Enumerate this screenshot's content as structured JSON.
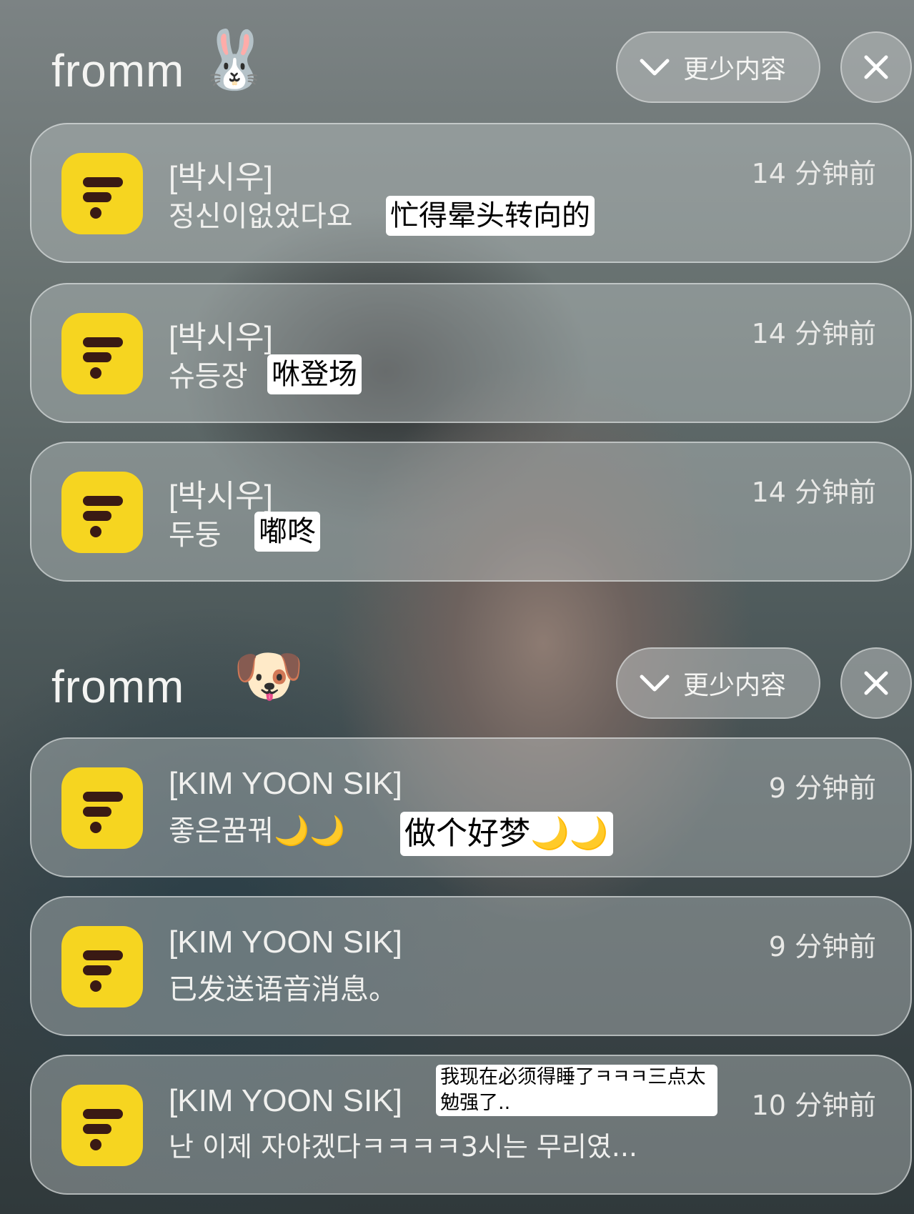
{
  "groups": [
    {
      "app_name": "fromm",
      "collapse_label": "更少内容",
      "notifications": [
        {
          "sender": "[박시우]",
          "message": "정신이없었다요",
          "translation": "忙得晕头转向的",
          "time": "14 分钟前"
        },
        {
          "sender": "[박시우]",
          "message": "슈등장",
          "translation": "咻登场",
          "time": "14 分钟前"
        },
        {
          "sender": "[박시우]",
          "message": "두둥",
          "translation": "嘟咚",
          "time": "14 分钟前"
        }
      ]
    },
    {
      "app_name": "fromm",
      "collapse_label": "更少内容",
      "notifications": [
        {
          "sender": "[KIM YOON SIK]",
          "message": "좋은꿈꿔🌙🌙",
          "translation": "做个好梦🌙🌙",
          "time": "9 分钟前"
        },
        {
          "sender": "[KIM YOON SIK]",
          "message": "已发送语音消息。",
          "time": "9 分钟前"
        },
        {
          "sender": "[KIM YOON SIK]",
          "message": "난 이제 자야겠다ㅋㅋㅋㅋ3시는 무리였...",
          "translation": "我现在必须得睡了ㅋㅋㅋ三点太勉强了..",
          "time": "10 分钟前"
        }
      ]
    }
  ],
  "icons": {
    "group1_emoji": "rabbit-face-emoji",
    "group2_emoji": "dog-face-emoji",
    "app_icon": "fromm-app-icon",
    "collapse_icon": "chevron-down-icon",
    "close_icon": "close-icon"
  },
  "colors": {
    "app_icon_bg": "#f6d520",
    "app_icon_glyph": "#3a1a14"
  }
}
